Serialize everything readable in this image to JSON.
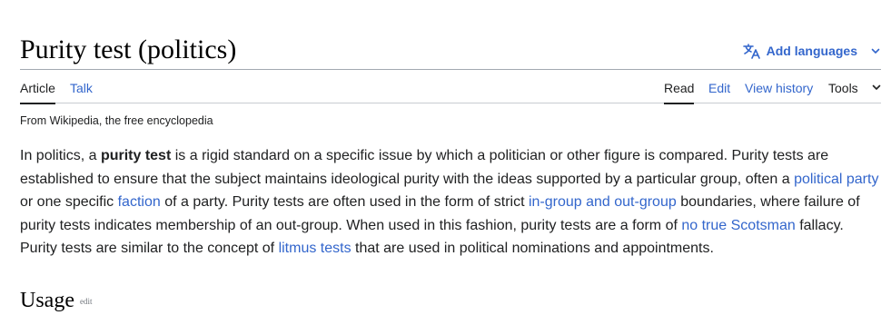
{
  "header": {
    "title": "Purity test (politics)",
    "add_languages_label": "Add languages",
    "icons": {
      "language": "translate-icon",
      "expand": "chevron-down-icon"
    }
  },
  "tabs": {
    "left": [
      {
        "label": "Article",
        "selected": true
      },
      {
        "label": "Talk",
        "selected": false
      }
    ],
    "right": [
      {
        "label": "Read",
        "selected": true
      },
      {
        "label": "Edit",
        "selected": false
      },
      {
        "label": "View history",
        "selected": false
      },
      {
        "label": "Tools",
        "selected": false
      }
    ]
  },
  "tagline": "From Wikipedia, the free encyclopedia",
  "article": {
    "t1": "In politics, a ",
    "bold_term": "purity test",
    "t2": " is a rigid standard on a specific issue by which a politician or other figure is compared. Purity tests are established to ensure that the subject maintains ideological purity with the ideas supported by a particular group, often a ",
    "link_political_party": "political party",
    "t3": " or one specific ",
    "link_faction": "faction",
    "t4": " of a party. Purity tests are often used in the form of strict ",
    "link_in_group": "in-group and out-group",
    "t5": " boundaries, where failure of purity tests indicates membership of an out-group. When used in this fashion, purity tests are a form of ",
    "link_no_true_scotsman": "no true Scotsman",
    "t6": " fallacy. Purity tests are similar to the concept of ",
    "link_litmus_tests": "litmus tests",
    "t7": " that are used in political nominations and appointments."
  },
  "next_section": {
    "heading": "Usage",
    "edit_label": "edit"
  },
  "colors": {
    "link": "#3366cc",
    "text": "#202122",
    "border": "#a2a9b1"
  }
}
